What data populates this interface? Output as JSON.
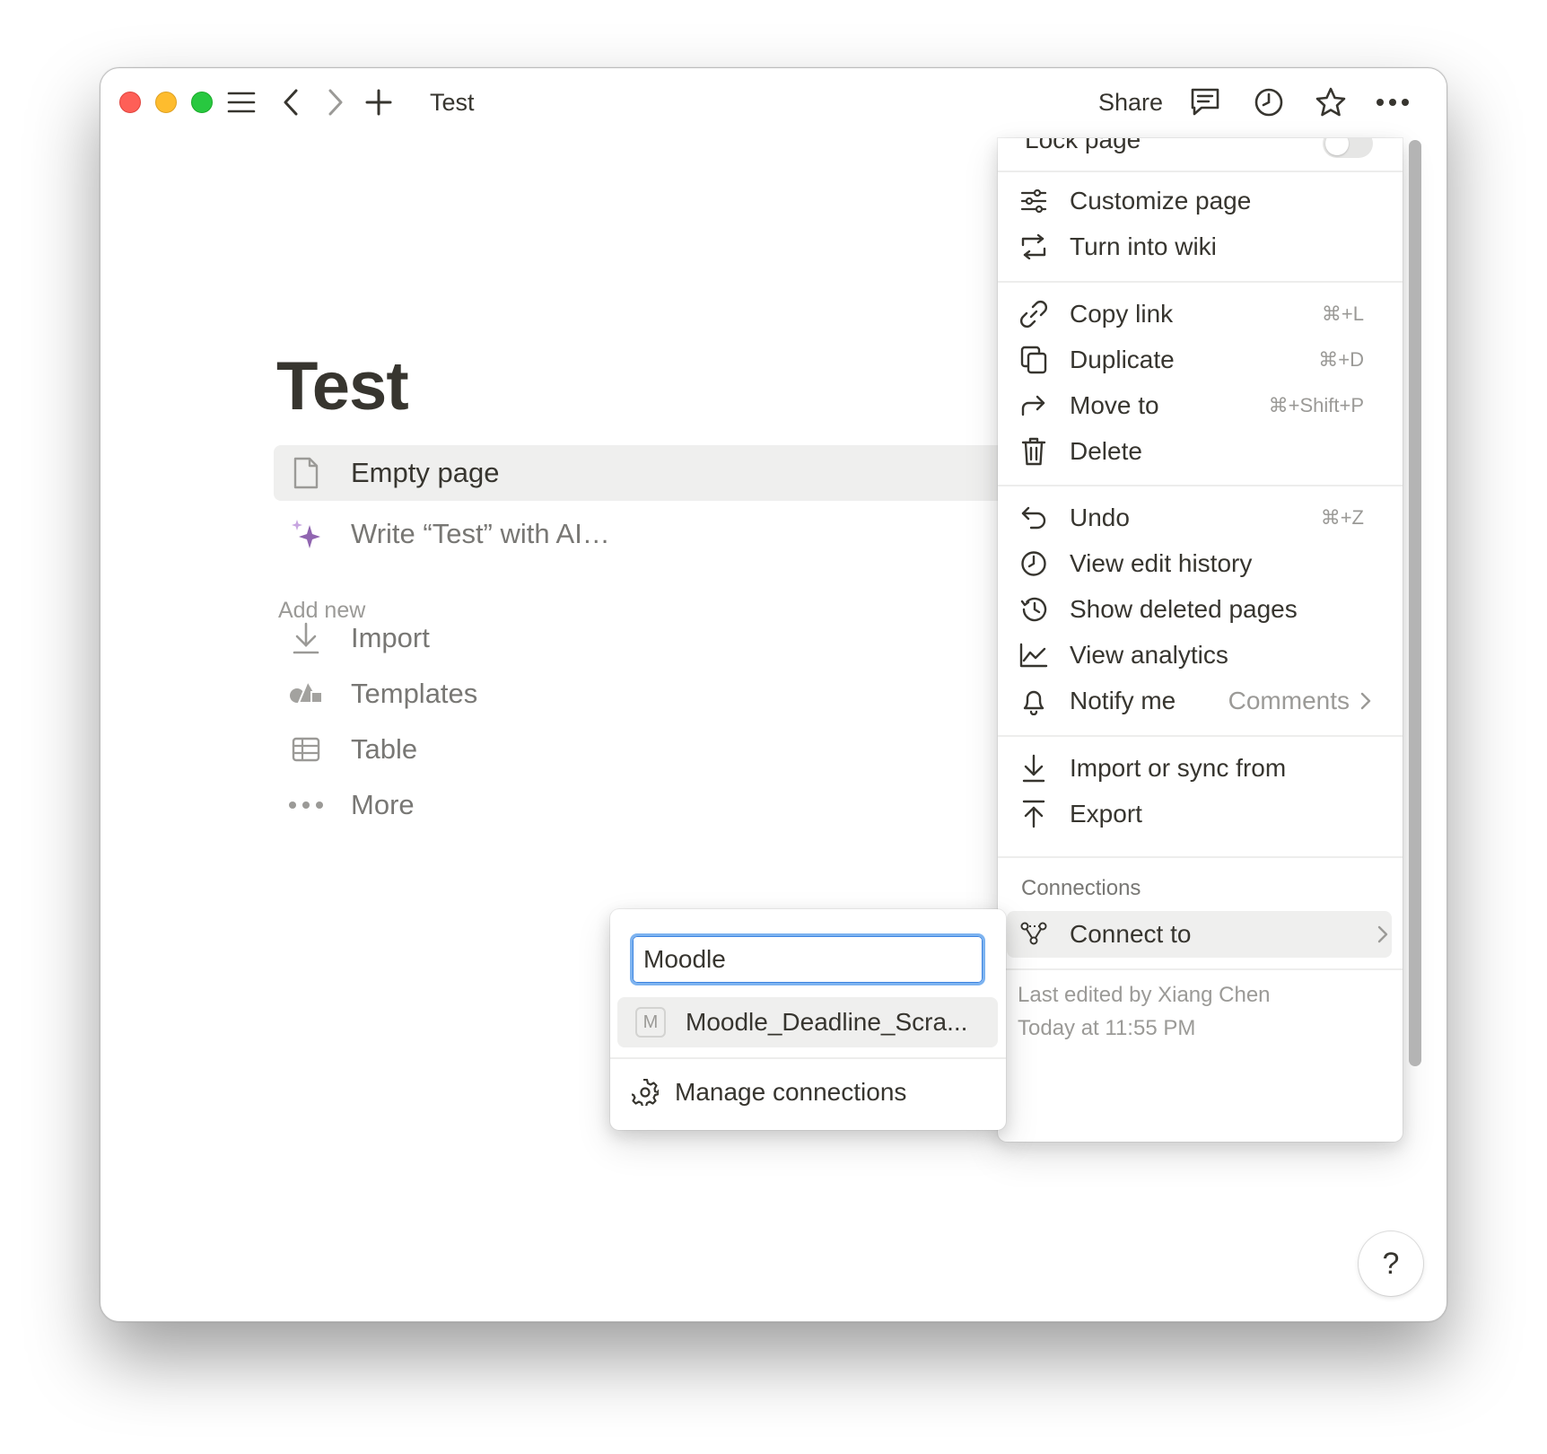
{
  "titlebar": {
    "breadcrumb": "Test",
    "share_label": "Share",
    "icons": [
      "sidebar-toggle-icon",
      "back-icon",
      "forward-icon",
      "new-page-icon",
      "comments-icon",
      "history-icon",
      "favorite-icon",
      "more-icon"
    ]
  },
  "page": {
    "title": "Test",
    "empty_page_label": "Empty page",
    "ai_label": "Write “Test” with AI…",
    "add_new_label": "Add new",
    "add_items": [
      {
        "label": "Import",
        "icon": "download-icon"
      },
      {
        "label": "Templates",
        "icon": "shapes-icon"
      },
      {
        "label": "Table",
        "icon": "table-icon"
      },
      {
        "label": "More",
        "icon": "more-dots-icon"
      }
    ]
  },
  "menu": {
    "lock_label": "Lock page",
    "items": [
      {
        "label": "Customize page",
        "shortcut": ""
      },
      {
        "label": "Turn into wiki",
        "shortcut": ""
      },
      {
        "label": "Copy link",
        "shortcut": "⌘+L"
      },
      {
        "label": "Duplicate",
        "shortcut": "⌘+D"
      },
      {
        "label": "Move to",
        "shortcut": "⌘+Shift+P"
      },
      {
        "label": "Delete",
        "shortcut": ""
      },
      {
        "label": "Undo",
        "shortcut": "⌘+Z"
      },
      {
        "label": "View edit history",
        "shortcut": ""
      },
      {
        "label": "Show deleted pages",
        "shortcut": ""
      },
      {
        "label": "View analytics",
        "shortcut": ""
      },
      {
        "label": "Notify me",
        "shortcut": "",
        "sub_value": "Comments"
      },
      {
        "label": "Import or sync from",
        "shortcut": ""
      },
      {
        "label": "Export",
        "shortcut": ""
      }
    ],
    "connections_label": "Connections",
    "connect_to_label": "Connect to",
    "last_edited": "Last edited by Xiang Chen",
    "last_edited_time": "Today at 11:55 PM"
  },
  "submenu": {
    "search_value": "Moodle",
    "result_badge": "M",
    "result_label": "Moodle_Deadline_Scra...",
    "manage_label": "Manage connections"
  },
  "help_label": "?",
  "colors": {
    "accent_blue": "#3d84e0",
    "hover_gray": "#efefee",
    "text": "#37352f",
    "muted": "#9b9a97",
    "ai_purple": "#9065b0"
  }
}
